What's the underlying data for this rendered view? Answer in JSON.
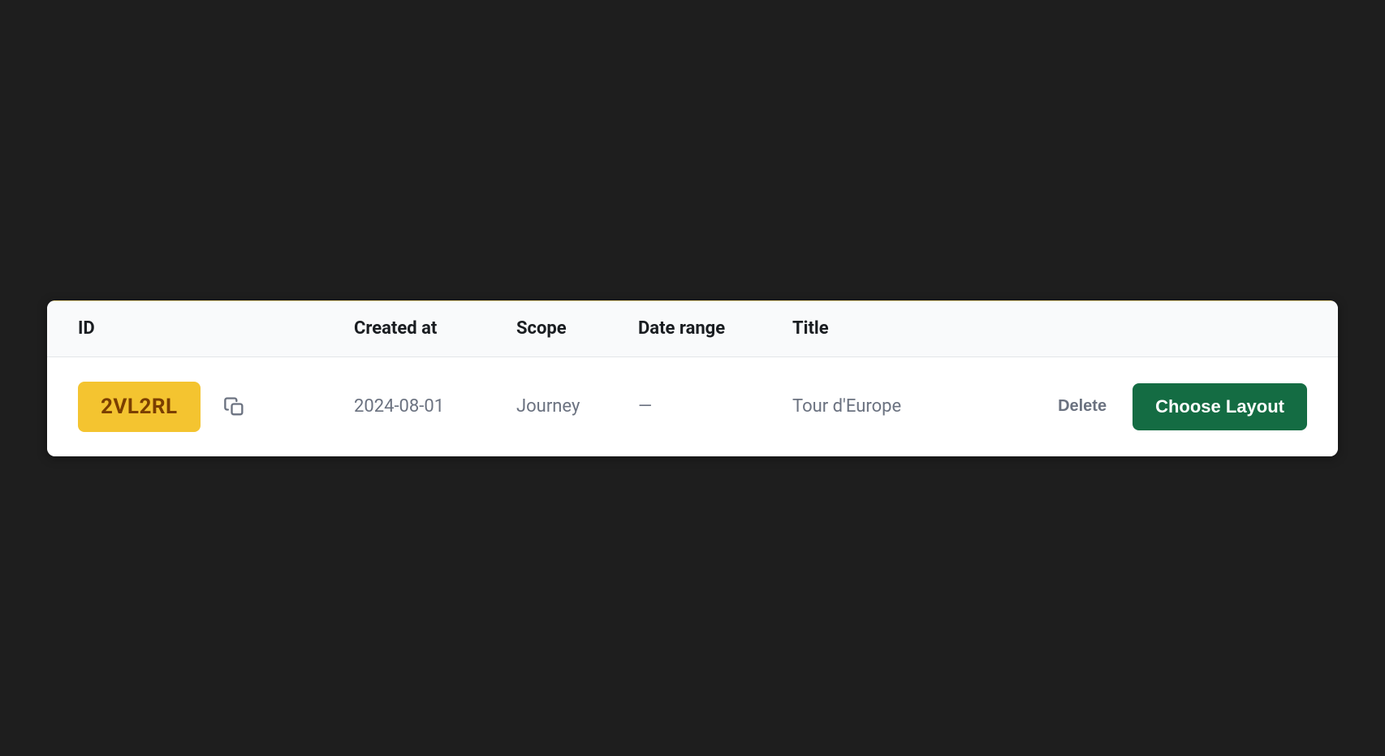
{
  "table": {
    "headers": {
      "id": "ID",
      "created_at": "Created at",
      "scope": "Scope",
      "date_range": "Date range",
      "title": "Title"
    },
    "rows": [
      {
        "id": "2VL2RL",
        "created_at": "2024-08-01",
        "scope": "Journey",
        "date_range": "—",
        "title": "Tour d'Europe"
      }
    ],
    "actions": {
      "delete": "Delete",
      "choose_layout": "Choose Layout"
    }
  }
}
